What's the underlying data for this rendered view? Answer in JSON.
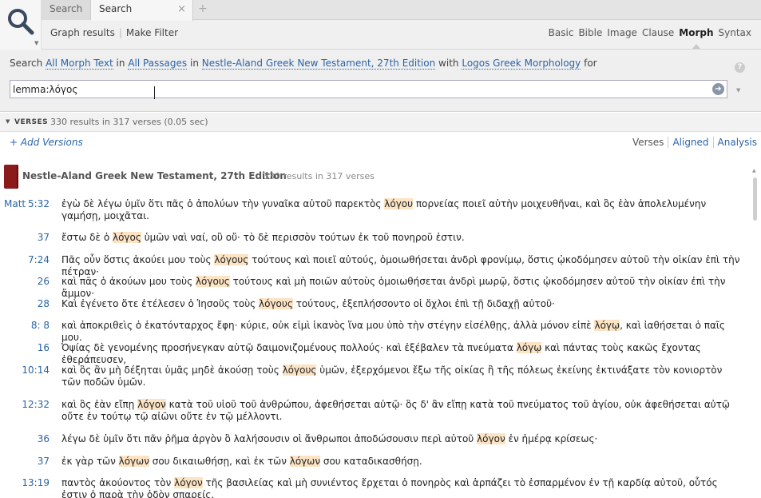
{
  "tabs": [
    {
      "label": "Search"
    },
    {
      "label": "Search",
      "close": "×"
    }
  ],
  "add_tab": "+",
  "toolbar": {
    "graph_results": "Graph results",
    "make_filter": "Make Filter"
  },
  "modes": [
    "Basic",
    "Bible",
    "Image",
    "Clause",
    "Morph",
    "Syntax"
  ],
  "active_mode": "Morph",
  "criteria": {
    "search": "Search",
    "morph_text": "All Morph Text",
    "in1": "in",
    "passages": "All Passages",
    "in2": "in",
    "edition": "Nestle-Aland Greek New Testament, 27th Edition",
    "with": "with",
    "morphology": "Logos Greek Morphology",
    "for": "for"
  },
  "help": "?",
  "query": {
    "value": "lemma:λόγος",
    "go": "➜"
  },
  "verses_section": {
    "label": "VERSES",
    "count": "330 results in 317 verses (0.05 sec)"
  },
  "add_versions": "+ Add Versions",
  "view_tabs": [
    "Verses",
    "Aligned",
    "Analysis"
  ],
  "book": {
    "title": "Nestle-Aland Greek New Testament, 27th Edition",
    "count": "330 results in 317 verses"
  },
  "results": [
    {
      "book": "Matt",
      "ref": "5:32",
      "pre": "ἐγὼ δὲ λέγω ὑμῖν ὅτι πᾶς ὁ ἀπολύων τὴν γυναῖκα αὐτοῦ παρεκτὸς ",
      "hit": "λόγου",
      "post": " πορνείας ποιεῖ αὐτὴν μοιχευθῆναι, καὶ ὃς ἐὰν ἀπολελυμένην γαμήσῃ, μοιχᾶται."
    },
    {
      "book": "",
      "ref": "37",
      "pre": "ἔστω δὲ ὁ ",
      "hit": "λόγος",
      "post": " ὑμῶν ναὶ ναί, οὒ οὔ· τὸ δὲ περισσὸν τούτων ἐκ τοῦ πονηροῦ ἐστιν."
    },
    {
      "book": "",
      "ref": "7:24",
      "pre": "Πᾶς οὖν ὅστις ἀκούει μου τοὺς ",
      "hit": "λόγους",
      "post": " τούτους καὶ ποιεῖ αὐτούς, ὁμοιωθήσεται ἀνδρὶ φρονίμῳ, ὅστις ᾠκοδόμησεν αὐτοῦ τὴν οἰκίαν ἐπὶ τὴν πέτραν·"
    },
    {
      "book": "",
      "ref": "26",
      "pre": "καὶ πᾶς ὁ ἀκούων μου τοὺς ",
      "hit": "λόγους",
      "post": " τούτους καὶ μὴ ποιῶν αὐτοὺς ὁμοιωθήσεται ἀνδρὶ μωρῷ, ὅστις ᾠκοδόμησεν αὐτοῦ τὴν οἰκίαν ἐπὶ τὴν ἄμμον·"
    },
    {
      "book": "",
      "ref": "28",
      "pre": "Καὶ ἐγένετο ὅτε ἐτέλεσεν ὁ Ἰησοῦς τοὺς ",
      "hit": "λόγους",
      "post": " τούτους, ἐξεπλήσσοντο οἱ ὄχλοι ἐπὶ τῇ διδαχῇ αὐτοῦ·"
    },
    {
      "book": "",
      "ref": "8: 8",
      "pre": "καὶ ἀποκριθεὶς ὁ ἑκατόνταρχος ἔφη· κύριε, οὐκ εἰμὶ ἱκανὸς ἵνα μου ὑπὸ τὴν στέγην εἰσέλθῃς, ἀλλὰ μόνον εἰπὲ ",
      "hit": "λόγῳ",
      "post": ", καὶ ἰαθήσεται ὁ παῖς μου."
    },
    {
      "book": "",
      "ref": "16",
      "pre": "Ὀψίας δὲ γενομένης προσήνεγκαν αὐτῷ δαιμονιζομένους πολλούς· καὶ ἐξέβαλεν τὰ πνεύματα ",
      "hit": "λόγῳ",
      "post": " καὶ πάντας τοὺς κακῶς ἔχοντας ἐθεράπευσεν,"
    },
    {
      "book": "",
      "ref": "10:14",
      "pre": "καὶ ὃς ἂν μὴ δέξηται ὑμᾶς μηδὲ ἀκούσῃ τοὺς ",
      "hit": "λόγους",
      "post": " ὑμῶν, ἐξερχόμενοι ἔξω τῆς οἰκίας ἢ τῆς πόλεως ἐκείνης ἐκτινάξατε τὸν κονιορτὸν τῶν ποδῶν ὑμῶν."
    },
    {
      "book": "",
      "ref": "12:32",
      "pre": "καὶ ὃς ἐὰν εἴπῃ ",
      "hit": "λόγον",
      "post": " κατὰ τοῦ υἱοῦ τοῦ ἀνθρώπου, ἀφεθήσεται αὐτῷ· ὃς δ' ἂν εἴπῃ κατὰ τοῦ πνεύματος τοῦ ἁγίου, οὐκ ἀφεθήσεται αὐτῷ οὔτε ἐν τούτῳ τῷ αἰῶνι οὔτε ἐν τῷ μέλλοντι."
    },
    {
      "book": "",
      "ref": "36",
      "pre": "λέγω δὲ ὑμῖν ὅτι πᾶν ῥῆμα ἀργὸν ὃ λαλήσουσιν οἱ ἄνθρωποι ἀποδώσουσιν περὶ αὐτοῦ ",
      "hit": "λόγον",
      "post": " ἐν ἡμέρᾳ κρίσεως·"
    },
    {
      "book": "",
      "ref": "37",
      "pre": "ἐκ γὰρ τῶν ",
      "hit": "λόγων",
      "post": " σου δικαιωθήσῃ, καὶ ἐκ τῶν ",
      "hit2": "λόγων",
      "post2": " σου καταδικασθήσῃ."
    },
    {
      "book": "",
      "ref": "13:19",
      "pre": "παντὸς ἀκούοντος τὸν ",
      "hit": "λόγον",
      "post": " τῆς βασιλείας καὶ μὴ συνιέντος ἔρχεται ὁ πονηρὸς καὶ ἁρπάζει τὸ ἐσπαρμένον ἐν τῇ καρδίᾳ αὐτοῦ, οὗτός ἐστιν ὁ παρὰ τὴν ὁδὸν σπαρείς."
    }
  ]
}
